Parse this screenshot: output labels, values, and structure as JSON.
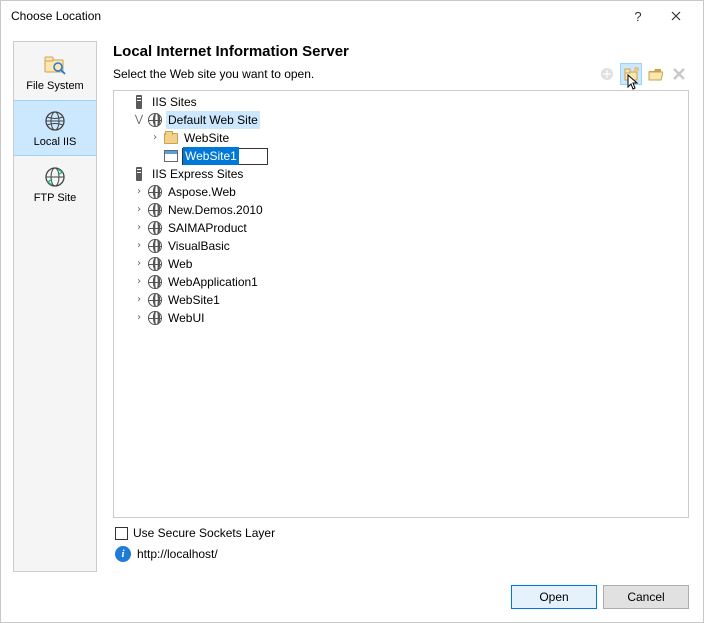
{
  "window": {
    "title": "Choose Location"
  },
  "sidebar": {
    "items": [
      {
        "label": "File System"
      },
      {
        "label": "Local IIS"
      },
      {
        "label": "FTP Site"
      }
    ]
  },
  "content": {
    "heading": "Local Internet Information Server",
    "subtitle": "Select the Web site you want to open.",
    "toolbar": {
      "create_app": "Create New Web Application",
      "create_vdir": "Create New Virtual Directory",
      "open_folder": "Open Folder",
      "delete": "Delete"
    }
  },
  "tree": {
    "iis_sites_label": "IIS Sites",
    "default_web_site": "Default Web Site",
    "website_folder": "WebSite",
    "editing_value": "WebSite1",
    "iis_express_label": "IIS Express Sites",
    "express_sites": [
      "Aspose.Web",
      "New.Demos.2010",
      "SAIMAProduct",
      "VisualBasic",
      "Web",
      "WebApplication1",
      "WebSite1",
      "WebUI"
    ]
  },
  "below": {
    "ssl_label": "Use Secure Sockets Layer",
    "url": "http://localhost/"
  },
  "footer": {
    "open": "Open",
    "cancel": "Cancel"
  }
}
